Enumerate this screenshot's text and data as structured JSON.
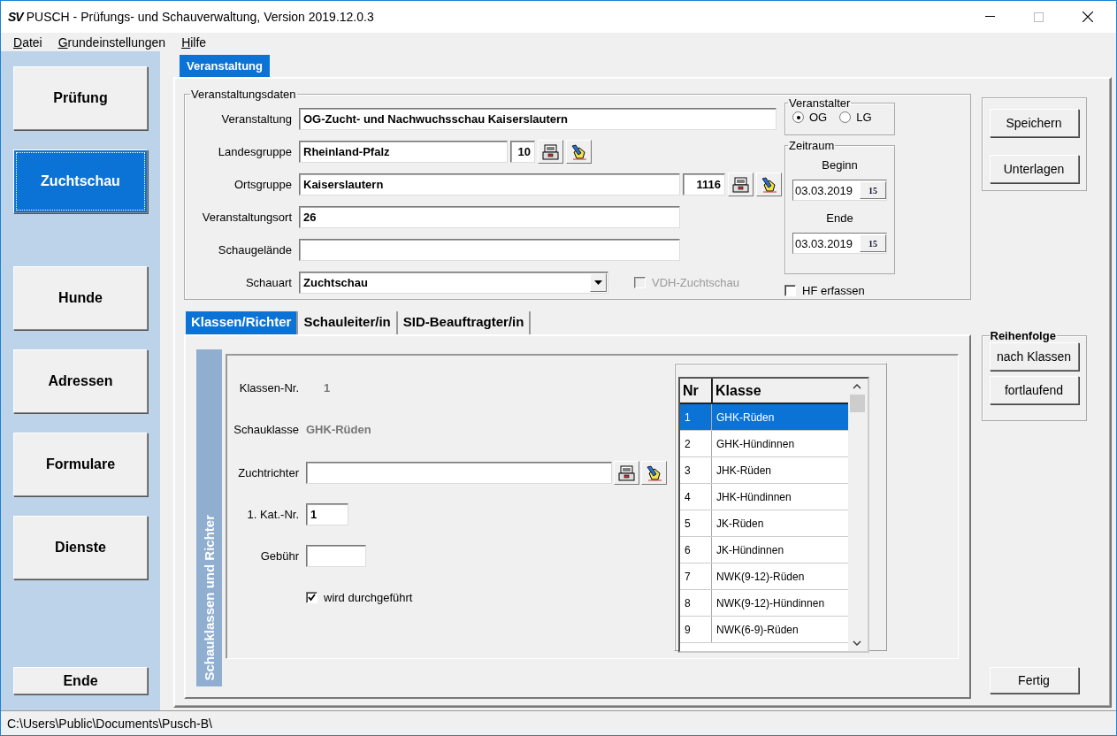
{
  "window": {
    "logo": "SV",
    "title": "PUSCH - Prüfungs- und Schauverwaltung, Version 2019.12.0.3"
  },
  "menu": [
    {
      "label": "Datei"
    },
    {
      "label": "Grundeinstellungen"
    },
    {
      "label": "Hilfe"
    }
  ],
  "sidebar": {
    "items": [
      {
        "label": "Prüfung",
        "selected": false
      },
      {
        "label": "Zuchtschau",
        "selected": true
      },
      {
        "label": "Hunde",
        "selected": false
      },
      {
        "label": "Adressen",
        "selected": false
      },
      {
        "label": "Formulare",
        "selected": false
      },
      {
        "label": "Dienste",
        "selected": false
      }
    ],
    "exit_button": "Ende"
  },
  "tabs": [
    {
      "label": "Veranstaltung",
      "selected": true
    }
  ],
  "event_group": {
    "legend": "Veranstaltungsdaten",
    "fields": [
      {
        "kind": "text",
        "label": "Veranstaltung",
        "value": "OG-Zucht- und Nachwuchsschau Kaiserslautern"
      },
      {
        "kind": "lookup",
        "label": "Landesgruppe",
        "value": "Rheinland-Pfalz",
        "code": "10"
      },
      {
        "kind": "lookup",
        "label": "Ortsgruppe",
        "value": "Kaiserslautern",
        "code": "1116"
      },
      {
        "kind": "text",
        "label": "Veranstaltungsort",
        "value": "26"
      },
      {
        "kind": "text",
        "label": "Schaugelände"
      },
      {
        "kind": "select",
        "label": "Schauart",
        "value": "Zuchtschau"
      }
    ],
    "vdh_checkbox": {
      "label": "VDH-Zuchtschau",
      "checked": false,
      "disabled": true
    },
    "organizer": {
      "legend": "Veranstalter",
      "options": [
        {
          "label": "OG",
          "selected": true
        },
        {
          "label": "LG",
          "selected": false
        }
      ]
    },
    "period": {
      "legend": "Zeitraum",
      "dates": [
        {
          "label": "Beginn",
          "value": "03.03.2019",
          "button": "15"
        },
        {
          "label": "Ende",
          "value": "03.03.2019",
          "button": "15"
        }
      ]
    },
    "hf_checkbox": {
      "label": "HF erfassen",
      "checked": false
    }
  },
  "actions": [
    "Speichern",
    "Unterlagen"
  ],
  "sub_tabs": [
    {
      "label": "Klassen/Richter",
      "selected": true
    },
    {
      "label": "Schauleiter/in",
      "selected": false
    },
    {
      "label": "SID-Beauftragter/in",
      "selected": false
    }
  ],
  "class_panel": {
    "side_title": "Schauklassen und Richter",
    "class_no_label": "Klassen-Nr.",
    "class_no": "1",
    "class_label": "Schauklasse",
    "class_value": "GHK-Rüden",
    "judge_label": "Zuchtrichter",
    "cat_label": "1. Kat.-Nr.",
    "cat_value": "1",
    "fee_label": "Gebühr",
    "held": {
      "label": "wird durchgeführt",
      "checked": true
    }
  },
  "class_table": {
    "columns": [
      "Nr",
      "Klasse"
    ],
    "rows": [
      {
        "nr": "1",
        "klasse": "GHK-Rüden",
        "selected": true
      },
      {
        "nr": "2",
        "klasse": "GHK-Hündinnen",
        "selected": false
      },
      {
        "nr": "3",
        "klasse": "JHK-Rüden",
        "selected": false
      },
      {
        "nr": "4",
        "klasse": "JHK-Hündinnen",
        "selected": false
      },
      {
        "nr": "5",
        "klasse": "JK-Rüden",
        "selected": false
      },
      {
        "nr": "6",
        "klasse": "JK-Hündinnen",
        "selected": false
      },
      {
        "nr": "7",
        "klasse": "NWK(9-12)-Rüden",
        "selected": false
      },
      {
        "nr": "8",
        "klasse": "NWK(9-12)-Hündinnen",
        "selected": false
      },
      {
        "nr": "9",
        "klasse": "NWK(6-9)-Rüden",
        "selected": false
      }
    ]
  },
  "order_group": {
    "legend": "Reihenfolge",
    "buttons": [
      "nach Klassen",
      "fortlaufend"
    ]
  },
  "done_button": "Fertig",
  "status_bar": "C:\\Users\\Public\\Documents\\Pusch-B\\"
}
